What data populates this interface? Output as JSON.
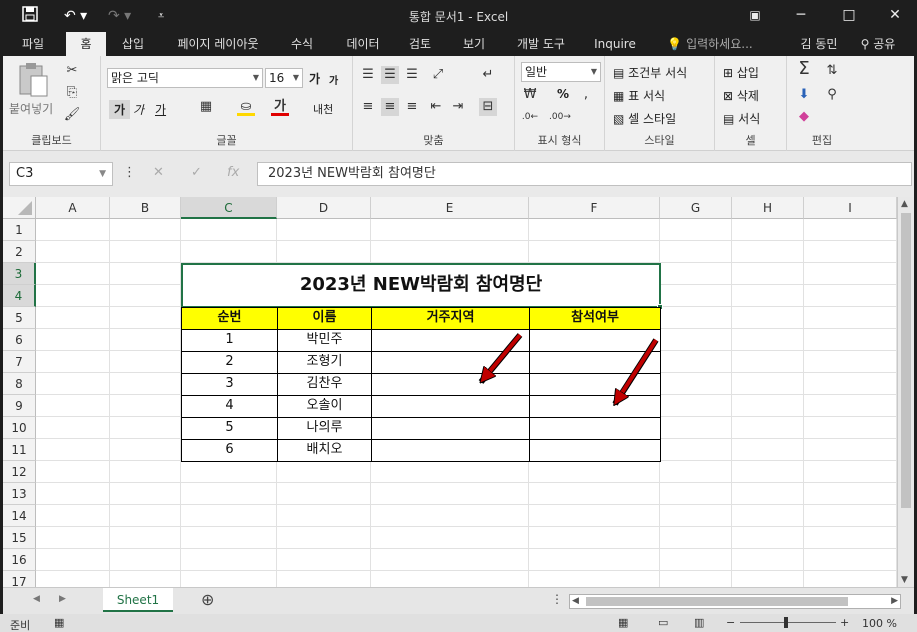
{
  "app": {
    "window_title": "통합 문서1 - Excel",
    "window_controls": {
      "restore_icon": "restore-icon",
      "minimize": "─",
      "maximize": "□",
      "close": "✕"
    }
  },
  "quick_access": {
    "save_icon": "save-icon",
    "undo_icon": "undo-icon",
    "redo_icon": "redo-icon",
    "customize_icon": "customize-icon"
  },
  "tabs": [
    {
      "label": "파일"
    },
    {
      "label": "홈"
    },
    {
      "label": "삽입"
    },
    {
      "label": "페이지 레이아웃"
    },
    {
      "label": "수식"
    },
    {
      "label": "데이터"
    },
    {
      "label": "검토"
    },
    {
      "label": "보기"
    },
    {
      "label": "개발 도구"
    },
    {
      "label": "Inquire"
    }
  ],
  "tell_me": "입력하세요...",
  "user": {
    "name": "김 동민",
    "share": "공유"
  },
  "ribbon": {
    "clipboard": {
      "label": "클립보드",
      "paste": "붙여넣기"
    },
    "font": {
      "label": "글꼴",
      "font_name": "맑은 고딕",
      "font_size": "16",
      "bold": "가",
      "italic": "가",
      "underline": "가",
      "grow": "가",
      "shrink": "가",
      "phonetic": "내천"
    },
    "alignment": {
      "label": "맞춤"
    },
    "number": {
      "label": "표시 형식",
      "format": "일반",
      "percent": "%"
    },
    "styles": {
      "label": "스타일",
      "conditional": "조건부 서식",
      "table": "표 서식",
      "cell_styles": "셀 스타일"
    },
    "cells": {
      "label": "셀",
      "insert": "삽입",
      "delete": "삭제",
      "format": "서식"
    },
    "editing": {
      "label": "편집"
    }
  },
  "formula_bar": {
    "name_box": "C3",
    "fx": "fx",
    "content": "2023년 NEW박람회 참여명단"
  },
  "columns": [
    "A",
    "B",
    "C",
    "D",
    "E",
    "F",
    "G",
    "H",
    "I"
  ],
  "rows": [
    "1",
    "2",
    "3",
    "4",
    "5",
    "6",
    "7",
    "8",
    "9",
    "10",
    "11",
    "12",
    "13",
    "14",
    "15",
    "16",
    "17"
  ],
  "sheet": {
    "title": "2023년 NEW박람회 참여명단",
    "headers": [
      "순번",
      "이름",
      "거주지역",
      "참석여부"
    ],
    "data": [
      [
        "1",
        "박민주",
        "",
        ""
      ],
      [
        "2",
        "조형기",
        "",
        ""
      ],
      [
        "3",
        "김찬우",
        "",
        ""
      ],
      [
        "4",
        "오솔이",
        "",
        ""
      ],
      [
        "5",
        "나의루",
        "",
        ""
      ],
      [
        "6",
        "배치오",
        "",
        ""
      ]
    ]
  },
  "sheet_tabs": [
    {
      "label": "Sheet1"
    }
  ],
  "status": {
    "ready": "준비",
    "zoom": "100 %"
  },
  "colors": {
    "accent": "#217346",
    "header_fill": "#ffff00",
    "arrow": "#c00000"
  }
}
